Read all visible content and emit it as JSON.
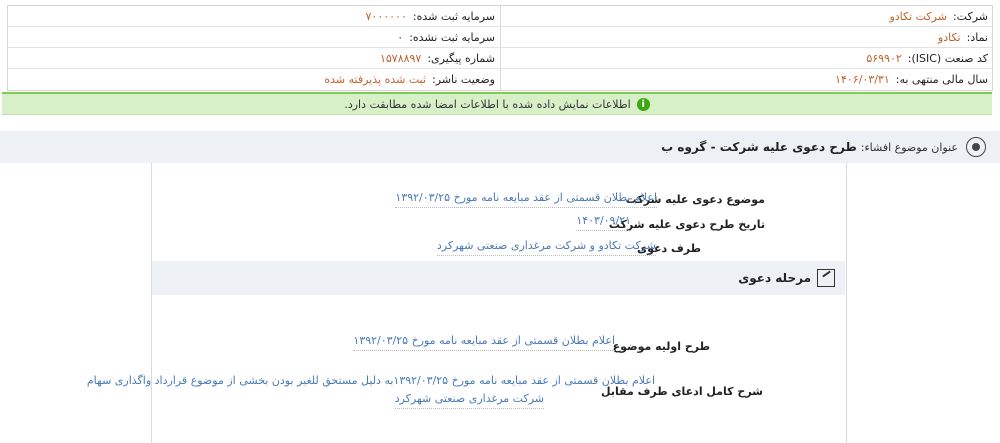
{
  "company_info": {
    "company_label": "شرکت:",
    "company_value": "شرکت تکادو",
    "symbol_label": "نماد:",
    "symbol_value": "تکادو",
    "isic_label": "کد صنعت (ISIC):",
    "isic_value": "۵۶۹۹۰۲",
    "fiscal_label": "سال مالی منتهی به:",
    "fiscal_value": "۱۴۰۶/۰۳/۳۱",
    "reg_capital_label": "سرمایه ثبت شده:",
    "reg_capital_value": "۷۰۰۰۰۰۰",
    "unreg_capital_label": "سرمایه ثبت نشده:",
    "unreg_capital_value": "۰",
    "tracking_label": "شماره پیگیری:",
    "tracking_value": "۱۵۷۸۸۹۷",
    "publisher_label": "وضعیت ناشر:",
    "publisher_value": "ثبت شده پذیرفته شده"
  },
  "notice": {
    "text": "اطلاعات نمایش داده شده با اطلاعات امضا شده مطابقت دارد."
  },
  "section": {
    "title_label": "عنوان موضوع افشاء:",
    "title_value": "طرح دعوی علیه شرکت - گروه ب"
  },
  "lawsuit": {
    "subject_label": "موضوع دعوی علیه شرکت",
    "subject_value": "اعلام بطلان قسمتی از عقد مبایعه نامه مورخ ۱۳۹۲/۰۳/۲۵",
    "date_label": "تاریخ طرح دعوی علیه شرکت",
    "date_value": "۱۴۰۳/۰۹/۲۱",
    "party_label": "طرف دعوی",
    "party_value": "شرکت تکادو و شرکت مرغداری صنعتی شهرکرد"
  },
  "stage": {
    "title": "مرحله دعوی",
    "initial_label": "طرح اولیه موضوع",
    "initial_value": "اعلام بطلان قسمتی از عقد مبایعه نامه مورخ ۱۳۹۲/۰۳/۲۵",
    "claim_label": "شرح کامل ادعای طرف مقابل",
    "claim_line1": "اعلام بطلان قسمتی از عقد مبایعه نامه مورخ ۱۳۹۲/۰۳/۲۵به دلیل مستحق للغیر بودن بخشی از موضوع قرارداد واگذاری سهام",
    "claim_line2": "شرکت مرغداری صنعتی شهرکرد"
  }
}
